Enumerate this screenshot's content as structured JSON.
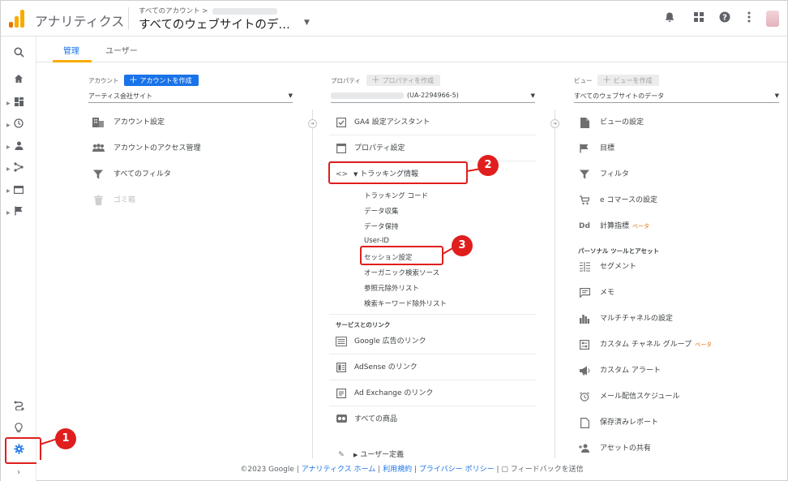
{
  "header": {
    "app_name": "アナリティクス",
    "breadcrumb": "すべてのアカウント >",
    "account_title": "すべてのウェブサイトのデ…"
  },
  "tabs": [
    "管理",
    "ユーザー"
  ],
  "account": {
    "label": "アカウント",
    "create_button": "アカウントを作成",
    "selected": "アーティス会社サイト",
    "items": [
      "アカウント設定",
      "アカウントのアクセス管理",
      "すべてのフィルタ",
      "ゴミ箱"
    ]
  },
  "property": {
    "label": "プロパティ",
    "create_button": "プロパティを作成",
    "selected_id": "(UA-2294966-5)",
    "items": [
      "GA4 設定アシスタント",
      "プロパティ設定"
    ],
    "tracking_label": "トラッキング情報",
    "tracking_sub": [
      "トラッキング コード",
      "データ収集",
      "データ保持",
      "User-ID",
      "セッション設定",
      "オーガニック検索ソース",
      "参照元除外リスト",
      "検索キーワード除外リスト"
    ],
    "links_heading": "サービスとのリンク",
    "links": [
      "Google 広告のリンク",
      "AdSense のリンク",
      "Ad Exchange のリンク",
      "すべての商品"
    ],
    "partial_item": "ユーザー定義"
  },
  "view": {
    "label": "ビュー",
    "create_button": "ビューを作成",
    "selected": "すべてのウェブサイトのデータ",
    "items": [
      "ビューの設定",
      "目標",
      "フィルタ",
      "e コマースの設定",
      "計算指標"
    ],
    "beta": "ベータ",
    "personal_heading": "パーソナル ツールとアセット",
    "personal": [
      "セグメント",
      "メモ",
      "マルチチャネルの設定",
      "カスタム チャネル グループ",
      "カスタム アラート",
      "メール配信スケジュール",
      "保存済みレポート",
      "アセットの共有"
    ]
  },
  "footer": {
    "copyright": "©2023 Google",
    "sep": "|",
    "home": "アナリティクス ホーム",
    "terms": "利用規約",
    "privacy": "プライバシー ポリシー",
    "feedback": "フィードバックを送信"
  },
  "annotations": [
    "1",
    "2",
    "3"
  ],
  "colors": {
    "accent": "#1a73e8",
    "highlight": "#e01e1e",
    "tab_underline": "#f9ab00"
  }
}
